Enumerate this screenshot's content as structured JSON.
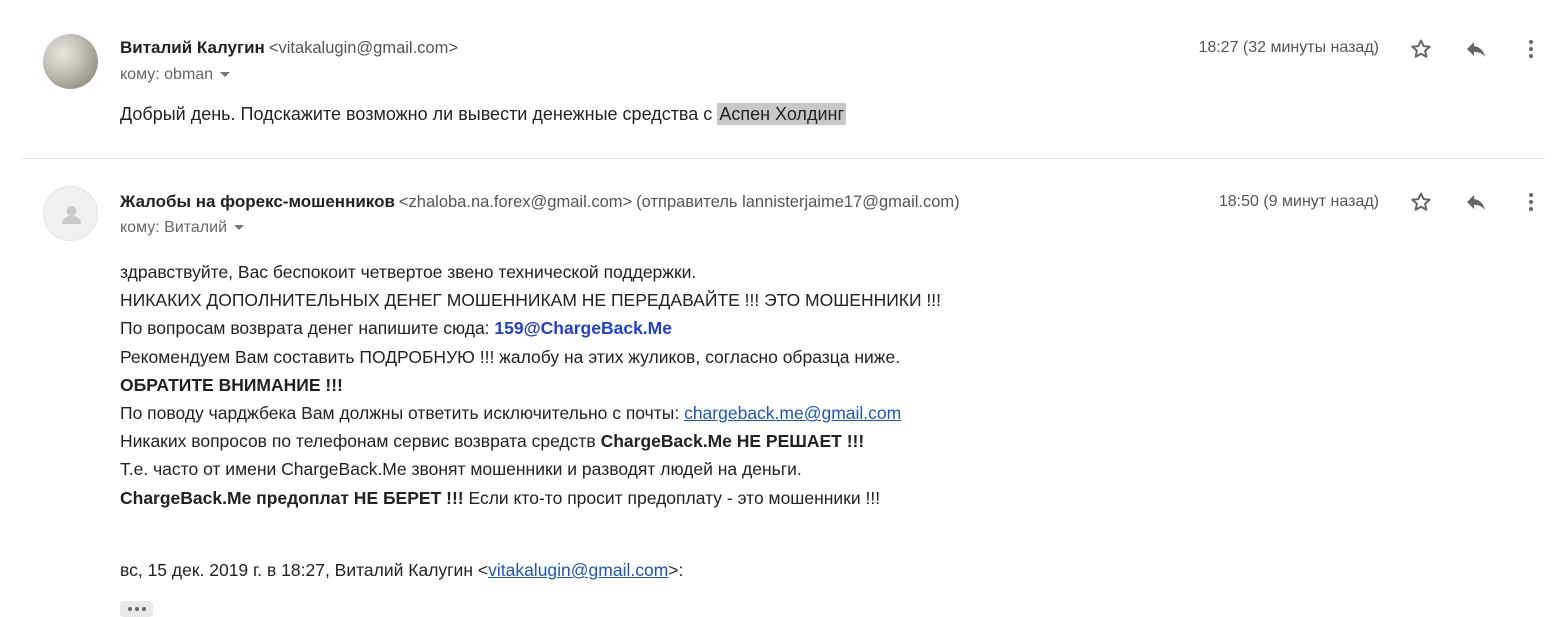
{
  "messages": [
    {
      "sender_name": "Виталий Калугин",
      "sender_email": "<vitakalugin@gmail.com>",
      "recipient": "кому: obman",
      "time": "18:27 (32 минуты назад)",
      "body_text": "Добрый день. Подскажите возможно ли вывести денежные средства с ",
      "body_highlight": "Аспен Холдинг"
    },
    {
      "sender_name": "Жалобы на форекс-мошенников",
      "sender_email": "<zhaloba.na.forex@gmail.com>",
      "sender_via": "(отправитель lannisterjaime17@gmail.com)",
      "recipient": "кому: Виталий",
      "time": "18:50 (9 минут назад)",
      "lines": {
        "l1": "здравствуйте, Вас беспокоит четвертое звено технической поддержки.",
        "l2": "НИКАКИХ ДОПОЛНИТЕЛЬНЫХ ДЕНЕГ МОШЕННИКАМ НЕ ПЕРЕДАВАЙТЕ !!! ЭТО МОШЕННИКИ !!!",
        "l3_text": "По вопросам возврата денег напишите сюда: ",
        "l3_email": "159@ChargeBack.Me",
        "l4": "Рекомендуем Вам составить ПОДРОБНУЮ !!! жалобу на этих жуликов, согласно образца ниже.",
        "l5": "ОБРАТИТЕ ВНИМАНИЕ !!!",
        "l6_text": "По поводу чарджбека Вам должны ответить исключительно с почты: ",
        "l6_link": "chargeback.me@gmail.com",
        "l7_text": "Никаких вопросов по телефонам сервис возврата средств ",
        "l7_bold": "ChargeBack.Me НЕ РЕШАЕТ !!!",
        "l8": "Т.е. часто от имени ChargeBack.Me звонят мошенники и разводят людей на деньги.",
        "l9_bold": "ChargeBack.Me предоплат НЕ БЕРЕТ !!!",
        "l9_text": " Если кто-то просит предоплату - это мошенники !!!"
      },
      "quote_prefix": "вс, 15 дек. 2019 г. в 18:27, Виталий Калугин <",
      "quote_email": "vitakalugin@gmail.com",
      "quote_suffix": ">:"
    }
  ],
  "icons": {
    "star": "star-icon",
    "reply": "reply-icon",
    "more": "more-vert-icon",
    "avatar_placeholder": "person-icon",
    "expand": "ellipsis-icon"
  },
  "colors": {
    "link": "#1a55c2",
    "email_highlight": "#1f3fd8",
    "selection": "#c8c8c8"
  }
}
